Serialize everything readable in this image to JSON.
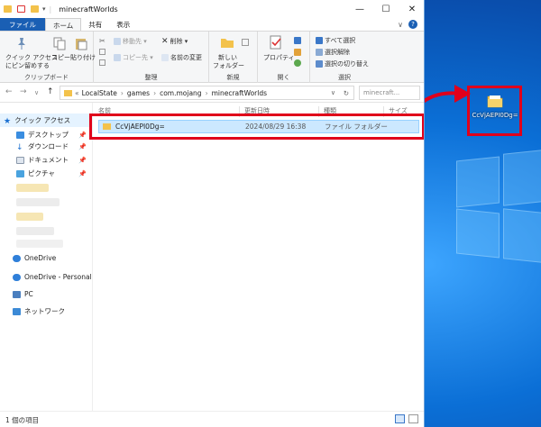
{
  "window": {
    "title": "minecraftWorlds",
    "controls": {
      "minimize": "—",
      "maximize": "☐",
      "close": "✕"
    }
  },
  "tabs": [
    {
      "label": "ファイル"
    },
    {
      "label": "ホーム"
    },
    {
      "label": "共有"
    },
    {
      "label": "表示"
    }
  ],
  "ribbon": {
    "clipboard": {
      "quick_access_line1": "クイック アクセス",
      "quick_access_line2": "にピン留めする",
      "copy": "コピー",
      "paste": "貼り付け",
      "group_label": "クリップボード"
    },
    "organize": {
      "move_to": "移動先 ▾",
      "copy_to": "コピー先 ▾",
      "delete": "削除 ▾",
      "rename": "名前の変更",
      "group_label": "整理"
    },
    "new": {
      "new_folder_line1": "新しい",
      "new_folder_line2": "フォルダー",
      "group_label": "新規"
    },
    "open": {
      "properties": "プロパティ",
      "group_label": "開く"
    },
    "select": {
      "select_all": "すべて選択",
      "select_none": "選択解除",
      "invert": "選択の切り替え",
      "group_label": "選択"
    }
  },
  "address": {
    "back": "←",
    "forward": "→",
    "recent": "∨",
    "up": "↑",
    "overflow": "«",
    "path": [
      "LocalState",
      "games",
      "com.mojang",
      "minecraftWorlds"
    ],
    "separator": "›",
    "search_placeholder": "minecraft..."
  },
  "sidebar": {
    "quick_access": "クイック アクセス",
    "items": [
      {
        "label": "デスクトップ",
        "pin": "📌"
      },
      {
        "label": "ダウンロード",
        "pin": "📌"
      },
      {
        "label": "ドキュメント",
        "pin": "📌"
      },
      {
        "label": "ピクチャ",
        "pin": "📌"
      }
    ],
    "onedrive": "OneDrive",
    "onedrive_personal": "OneDrive - Personal",
    "pc": "PC",
    "network": "ネットワーク"
  },
  "columns": {
    "name": "名前",
    "date": "更新日時",
    "type": "種類",
    "size": "サイズ"
  },
  "files": [
    {
      "name": "CcVjAEPI0Dg=",
      "date": "2024/08/29 16:38",
      "type": "ファイル フォルダー"
    }
  ],
  "status": {
    "count": "1 個の項目"
  },
  "desktop_icon": {
    "label": "CcVjAEPI0Dg="
  },
  "colors": {
    "accent": "#1a5fb4",
    "selection": "#cce8ff",
    "highlight_box": "#e0001b",
    "folder": "#f3c24b"
  }
}
